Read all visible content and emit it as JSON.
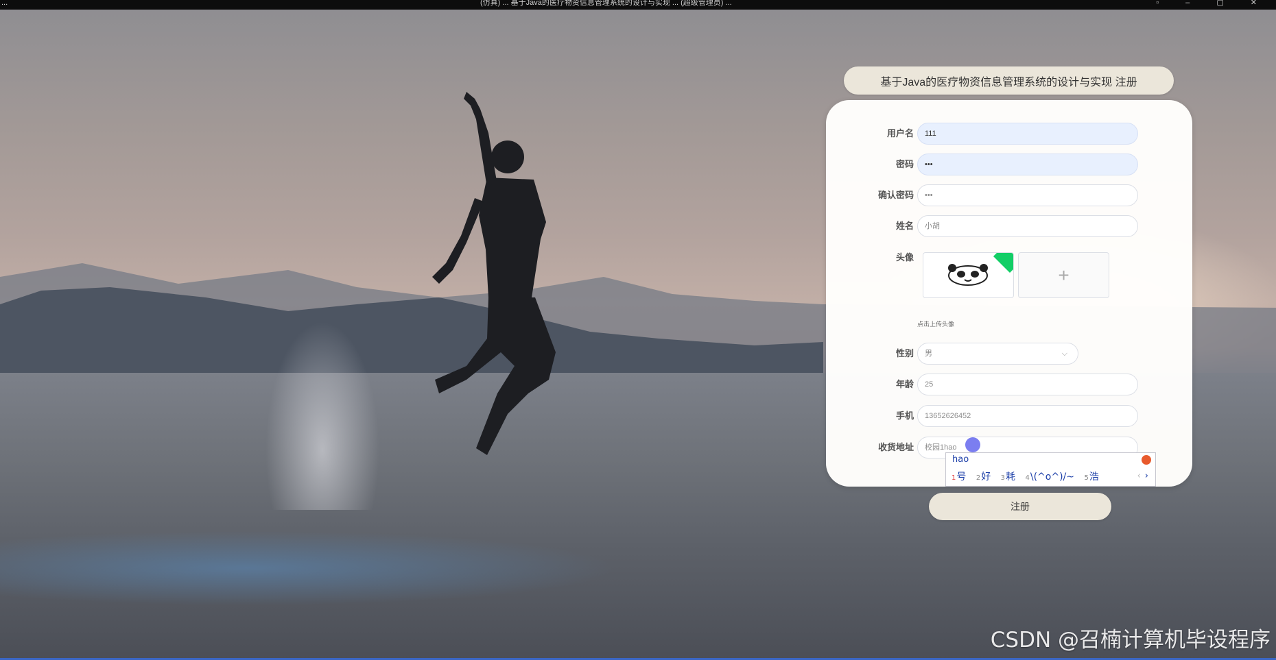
{
  "window": {
    "title": "(仿真)  ...  基于Java的医疗物资信息管理系统的设计与实现  ...  (超级管理员)  ...",
    "left_label": "..."
  },
  "register": {
    "title": "基于Java的医疗物资信息管理系统的设计与实现 注册",
    "fields": {
      "username": {
        "label": "用户名",
        "value": "111"
      },
      "password": {
        "label": "密码",
        "value": "•••"
      },
      "confirm_password": {
        "label": "确认密码",
        "value": "•••"
      },
      "name": {
        "label": "姓名",
        "value": "小胡"
      },
      "avatar": {
        "label": "头像",
        "upload_tip": "点击上传头像",
        "add_icon": "+"
      },
      "gender": {
        "label": "性别",
        "value": "男",
        "arrow": "⌵"
      },
      "age": {
        "label": "年龄",
        "value": "25"
      },
      "phone": {
        "label": "手机",
        "value": "13652626452"
      },
      "address": {
        "label": "收货地址",
        "value": "校园1hao"
      }
    },
    "submit_label": "注册"
  },
  "ime": {
    "composition": "hao",
    "candidates": [
      {
        "num": "1",
        "text": "号"
      },
      {
        "num": "2",
        "text": "好"
      },
      {
        "num": "3",
        "text": "耗"
      },
      {
        "num": "4",
        "text": "\\(^o^)/~"
      },
      {
        "num": "5",
        "text": "浩"
      }
    ],
    "prev": "‹",
    "next": "›"
  },
  "watermark": "CSDN @召楠计算机毕设程序",
  "colors": {
    "pill": "#ebe6da",
    "avatar_corner": "#13ce66",
    "autofill": "#e8f0fe",
    "ime_text": "#1b3ea8"
  },
  "icons": {
    "select_arrow": "chevron-down-icon",
    "upload": "plus-icon",
    "avatar": "panda-avatar-icon"
  }
}
